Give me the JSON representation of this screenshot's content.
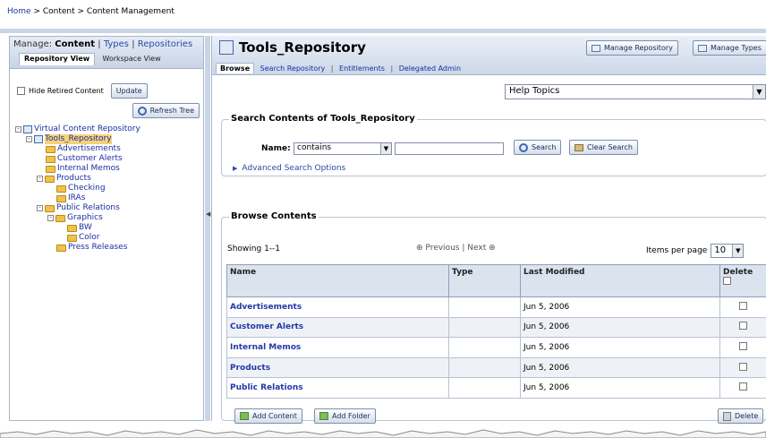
{
  "breadcrumb": {
    "home": "Home",
    "sep1": " > ",
    "content": "Content",
    "sep2": " > ",
    "current": "Content Management"
  },
  "left": {
    "manage_prefix": "Manage:",
    "manage_content": "Content",
    "manage_types": "Types",
    "manage_repositories": "Repositories",
    "divider": "|",
    "repository_view": "Repository View",
    "workspace_view": "Workspace View",
    "hide_retired": "Hide Retired Content",
    "update": "Update",
    "refresh_tree": "Refresh Tree"
  },
  "tree": {
    "root": "Virtual Content Repository",
    "repo": "Tools_Repository",
    "advertisements": "Advertisements",
    "customer_alerts": "Customer Alerts",
    "internal_memos": "Internal Memos",
    "products": "Products",
    "checking": "Checking",
    "iras": "IRAs",
    "public_relations": "Public Relations",
    "graphics": "Graphics",
    "bw": "BW",
    "color": "Color",
    "press_releases": "Press Releases"
  },
  "main": {
    "title": "Tools_Repository",
    "manage_repository": "Manage Repository",
    "manage_types": "Manage Types",
    "tabs": [
      "Browse",
      "Search Repository",
      "Entitlements",
      "Delegated Admin"
    ],
    "tab_sep": "|",
    "help_topics": "Help Topics"
  },
  "search": {
    "legend": "Search Contents of Tools_Repository",
    "name_label": "Name:",
    "operator": "contains",
    "query": "",
    "search_btn": "Search",
    "clear_btn": "Clear Search",
    "advanced": "Advanced Search Options"
  },
  "browse": {
    "legend": "Browse Contents",
    "showing": "Showing 1--1",
    "previous": "Previous",
    "pager_sep": "|",
    "next": "Next",
    "items_per_page_label": "Items per page",
    "items_per_page": "10",
    "headers": {
      "name": "Name",
      "type": "Type",
      "modified": "Last Modified",
      "delete": "Delete"
    },
    "rows": [
      {
        "name": "Advertisements",
        "type": "",
        "modified": "Jun 5, 2006"
      },
      {
        "name": "Customer Alerts",
        "type": "",
        "modified": "Jun 5, 2006"
      },
      {
        "name": "Internal Memos",
        "type": "",
        "modified": "Jun 5, 2006"
      },
      {
        "name": "Products",
        "type": "",
        "modified": "Jun 5, 2006"
      },
      {
        "name": "Public Relations",
        "type": "",
        "modified": "Jun 5, 2006"
      }
    ],
    "add_content": "Add Content",
    "add_folder": "Add Folder",
    "delete_btn": "Delete"
  }
}
